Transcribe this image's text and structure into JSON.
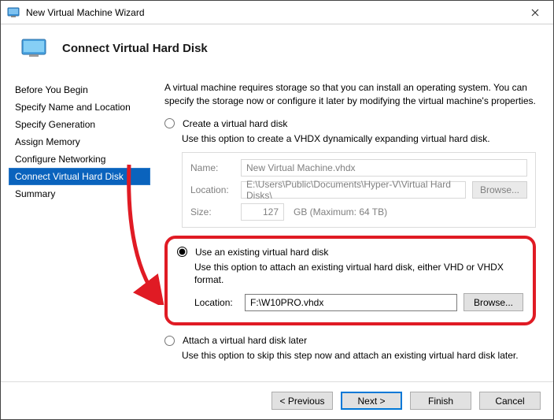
{
  "window": {
    "title": "New Virtual Machine Wizard"
  },
  "header": {
    "title": "Connect Virtual Hard Disk"
  },
  "sidebar": {
    "items": [
      {
        "label": "Before You Begin"
      },
      {
        "label": "Specify Name and Location"
      },
      {
        "label": "Specify Generation"
      },
      {
        "label": "Assign Memory"
      },
      {
        "label": "Configure Networking"
      },
      {
        "label": "Connect Virtual Hard Disk"
      },
      {
        "label": "Summary"
      }
    ]
  },
  "content": {
    "intro": "A virtual machine requires storage so that you can install an operating system. You can specify the storage now or configure it later by modifying the virtual machine's properties.",
    "opt1": {
      "label": "Create a virtual hard disk",
      "desc": "Use this option to create a VHDX dynamically expanding virtual hard disk.",
      "name_label": "Name:",
      "name_value": "New Virtual Machine.vhdx",
      "loc_label": "Location:",
      "loc_value": "E:\\Users\\Public\\Documents\\Hyper-V\\Virtual Hard Disks\\",
      "browse": "Browse...",
      "size_label": "Size:",
      "size_value": "127",
      "size_unit": "GB (Maximum: 64 TB)"
    },
    "opt2": {
      "label": "Use an existing virtual hard disk",
      "desc": "Use this option to attach an existing virtual hard disk, either VHD or VHDX format.",
      "loc_label": "Location:",
      "loc_value": "F:\\W10PRO.vhdx",
      "browse": "Browse..."
    },
    "opt3": {
      "label": "Attach a virtual hard disk later",
      "desc": "Use this option to skip this step now and attach an existing virtual hard disk later."
    }
  },
  "footer": {
    "previous": "< Previous",
    "next": "Next >",
    "finish": "Finish",
    "cancel": "Cancel"
  }
}
